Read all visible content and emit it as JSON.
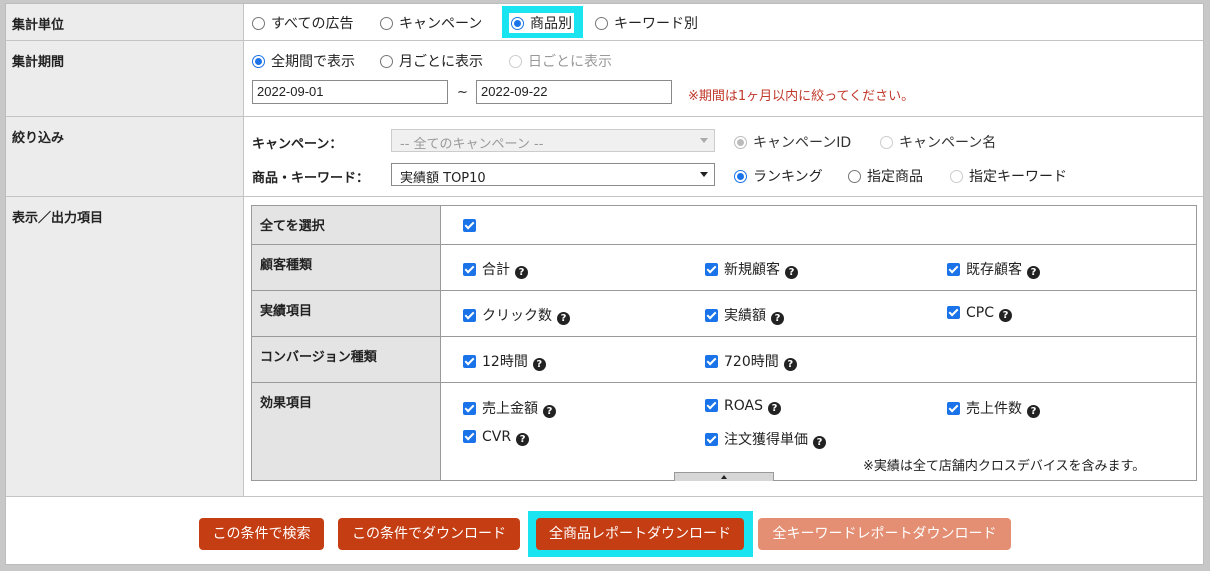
{
  "rows": {
    "aggregation_unit": {
      "label": "集計単位",
      "options": [
        "すべての広告",
        "キャンペーン",
        "商品別",
        "キーワード別"
      ],
      "selected": "商品別"
    },
    "period": {
      "label": "集計期間",
      "options": [
        "全期間で表示",
        "月ごとに表示",
        "日ごとに表示"
      ],
      "selected": "全期間で表示",
      "start_date": "2022-09-01",
      "separator": "~",
      "end_date": "2022-09-22",
      "note": "※期間は1ヶ月以内に絞ってください。"
    },
    "filter": {
      "label": "絞り込み",
      "campaign_label": "キャンペーン：",
      "campaign_select": "-- 全てのキャンペーン --",
      "campaign_options": [
        "キャンペーンID",
        "キャンペーン名"
      ],
      "product_label": "商品・キーワード：",
      "product_select": "実績額 TOP10",
      "product_options": [
        "ランキング",
        "指定商品",
        "指定キーワード"
      ]
    },
    "display": {
      "label": "表示／出力項目",
      "select_all": "全てを選択",
      "groups": [
        {
          "label": "顧客種類",
          "items": [
            "合計",
            "新規顧客",
            "既存顧客"
          ]
        },
        {
          "label": "実績項目",
          "items": [
            "クリック数",
            "実績額",
            "CPC"
          ]
        },
        {
          "label": "コンバージョン種類",
          "items": [
            "12時間",
            "720時間"
          ]
        },
        {
          "label": "効果項目",
          "items": [
            "売上金額",
            "ROAS",
            "売上件数",
            "CVR",
            "注文獲得単価"
          ]
        }
      ],
      "footnote": "※実績は全て店舗内クロスデバイスを含みます。"
    }
  },
  "help_glyph": "?",
  "buttons": {
    "search": "この条件で検索",
    "download": "この条件でダウンロード",
    "all_products_report": "全商品レポートダウンロード",
    "all_keywords_report": "全キーワードレポートダウンロード"
  },
  "colors": {
    "button": "#c53d12",
    "button_disabled": "#e48f73",
    "highlight": "#19e4f0",
    "note": "#c0392b",
    "accent": "#1a73e8"
  }
}
